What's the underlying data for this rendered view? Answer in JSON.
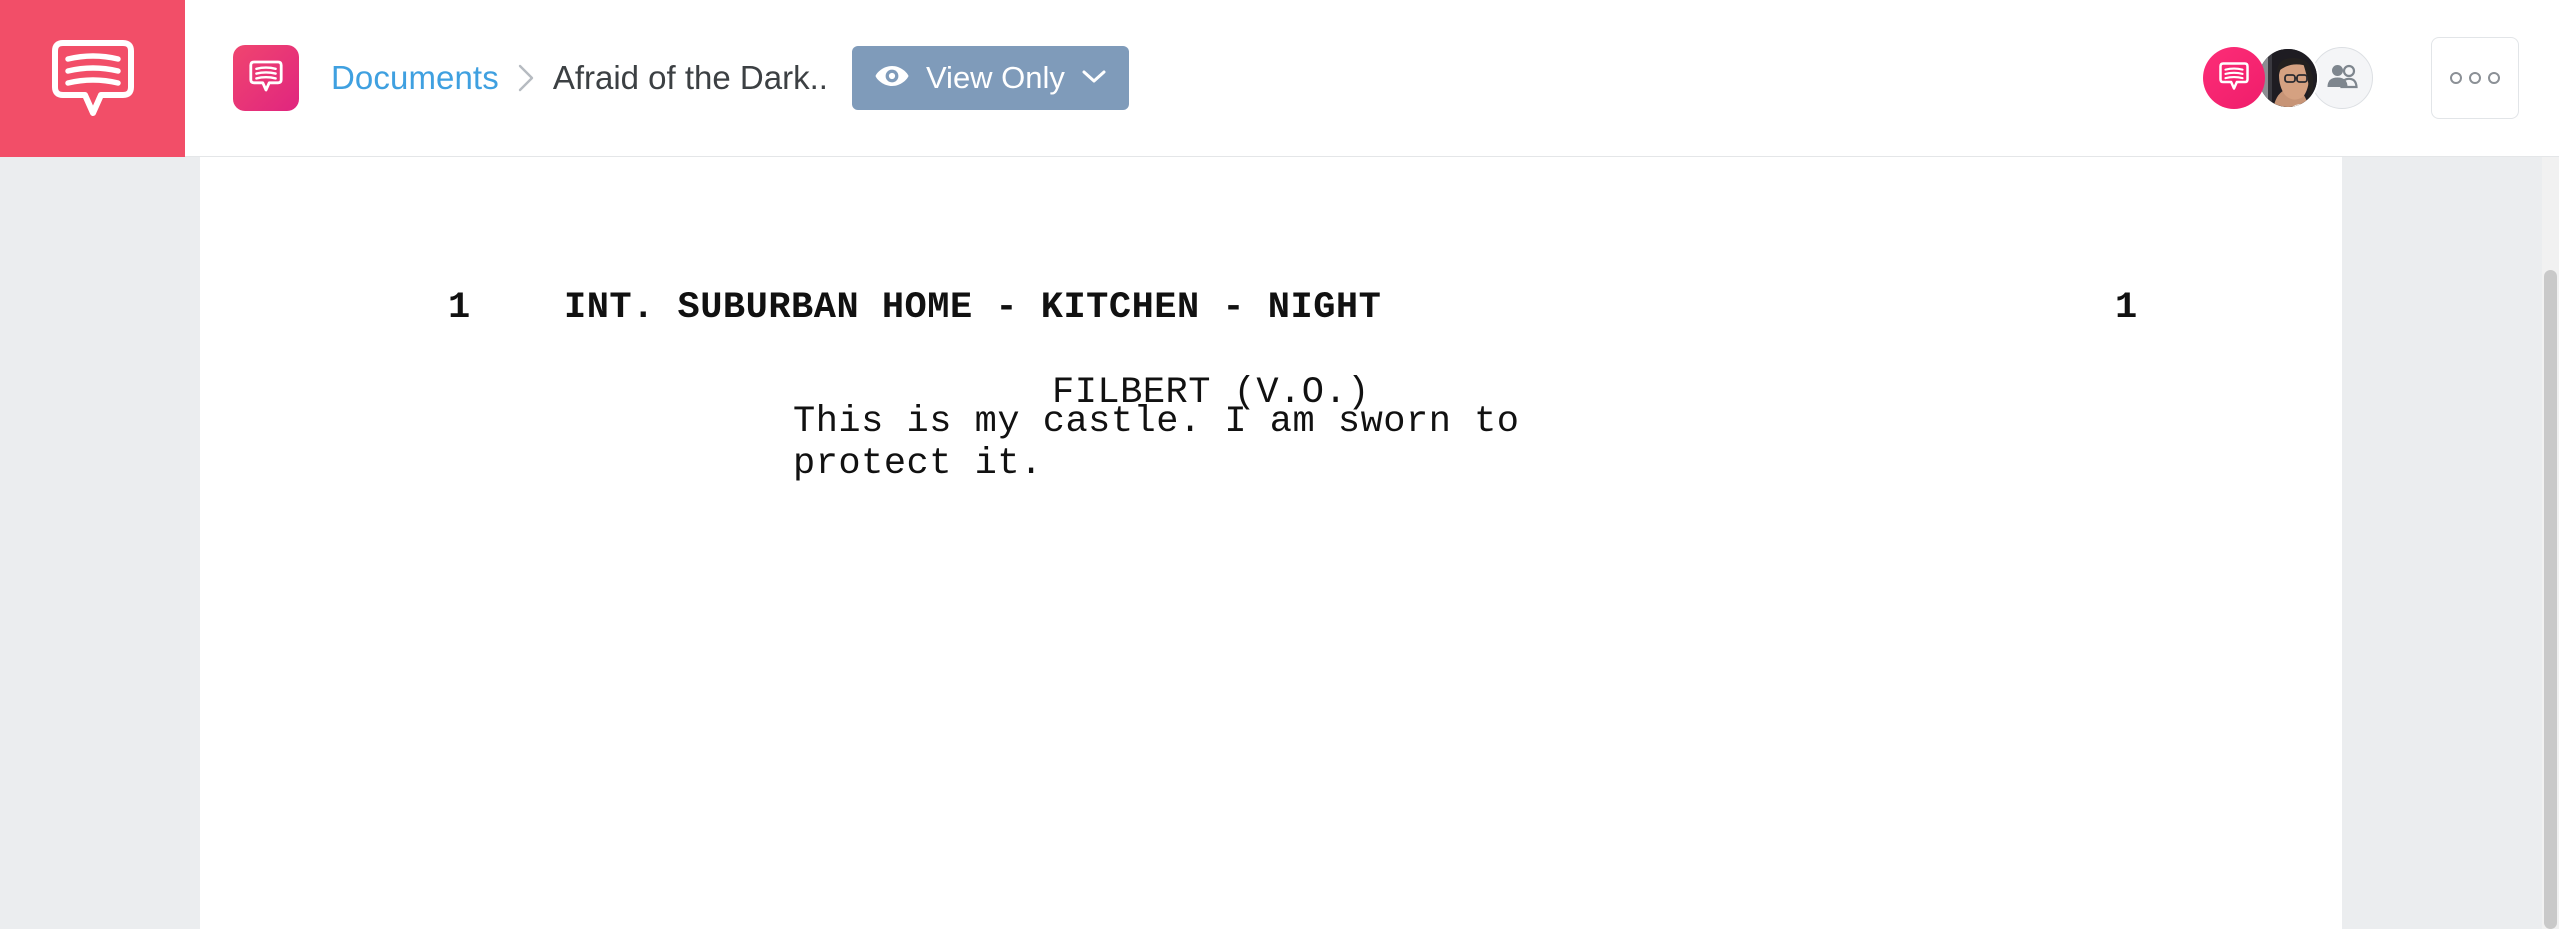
{
  "brand": {
    "logo_icon": "speech-bubble-logo-icon",
    "logo_bg_color": "#F24E68",
    "doc_badge_icon": "speech-bubble-icon",
    "doc_badge_color": "#E8306F"
  },
  "header": {
    "breadcrumb": {
      "parent_label": "Documents",
      "separator": "›",
      "current_label": "Afraid of the Dark..",
      "link_color": "#3FA0E0"
    },
    "view_mode_button": {
      "label": "View Only",
      "eye_icon": "eye-icon",
      "chevron_icon": "chevron-down-icon",
      "bg_color": "#7F9BBA"
    },
    "avatars": [
      {
        "name": "chat-avatar",
        "type": "icon",
        "icon": "speech-bubble-icon",
        "color": "#FD2D77"
      },
      {
        "name": "user-avatar",
        "type": "photo",
        "icon": "person-photo"
      },
      {
        "name": "add-collaborator-avatar",
        "type": "icon",
        "icon": "add-people-icon",
        "color": "#F4F5F7"
      }
    ],
    "more_button": {
      "icon": "ellipsis-icon",
      "dots": 3
    }
  },
  "document": {
    "scene": {
      "number_left": "1",
      "heading": "INT. SUBURBAN HOME - KITCHEN - NIGHT",
      "number_right": "1"
    },
    "character": "FILBERT (V.O.)",
    "dialogue": "This is my castle. I am sworn to\nprotect it."
  },
  "scrollbar": {
    "orientation": "vertical",
    "thumb_position_pct": 15
  }
}
